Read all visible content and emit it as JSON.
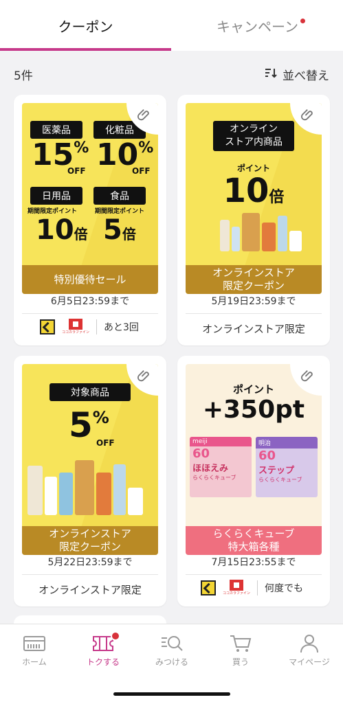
{
  "tabs": {
    "coupon": "クーポン",
    "campaign": "キャンペーン"
  },
  "toolbar": {
    "count": "5件",
    "sort_label": "並べ替え"
  },
  "cards": [
    {
      "tags": [
        "医薬品",
        "化粧品",
        "日用品",
        "食品"
      ],
      "percent1": "15",
      "percent2": "10",
      "pct_symbol": "%",
      "off": "OFF",
      "sub_label": "期間限定ポイント",
      "mult1": "10",
      "mult2": "5",
      "bai": "倍",
      "strip": "特別優待セール",
      "expiry": "6月5日23:59まで",
      "logo_text": "ココカラファイン",
      "foot": "あと3回"
    },
    {
      "tag_line1": "オンライン",
      "tag_line2": "ストア内商品",
      "point_label": "ポイント",
      "mult": "10",
      "bai": "倍",
      "strip_line1": "オンラインストア",
      "strip_line2": "限定クーポン",
      "expiry": "5月19日23:59まで",
      "foot": "オンラインストア限定"
    },
    {
      "tag": "対象商品",
      "percent": "5",
      "pct_symbol": "%",
      "off": "OFF",
      "strip_line1": "オンラインストア",
      "strip_line2": "限定クーポン",
      "expiry": "5月22日23:59まで",
      "foot": "オンラインストア限定"
    },
    {
      "point_label": "ポイント",
      "amount": "+350pt",
      "box1": {
        "brand": "meiji",
        "big": "60",
        "name": "ほほえみ",
        "sub": "らくらくキューブ"
      },
      "box2": {
        "brand": "明治",
        "big": "60",
        "name": "ステップ",
        "sub": "らくらくキューブ"
      },
      "strip_line1": "らくらくキューブ",
      "strip_line2": "特大箱各種",
      "expiry": "7月15日23:55まで",
      "logo_text": "ココカラファイン",
      "foot": "何度でも"
    }
  ],
  "nav": [
    "ホーム",
    "トクする",
    "みつける",
    "買う",
    "マイページ"
  ],
  "colors": {
    "accent": "#c6398a",
    "banner_yellow": "#f7e45a",
    "strip_gold": "#b98a25",
    "strip_pink": "#ef6f7f",
    "badge_red": "#d8323a"
  }
}
